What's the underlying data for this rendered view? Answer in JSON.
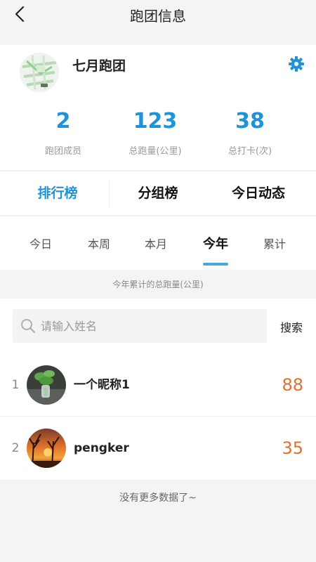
{
  "header": {
    "title": "跑团信息"
  },
  "club": {
    "name": "七月跑团",
    "stats": [
      {
        "value": "2",
        "label": "跑团成员"
      },
      {
        "value": "123",
        "label": "总跑量(公里)"
      },
      {
        "value": "38",
        "label": "总打卡(次)"
      }
    ]
  },
  "main_tabs": [
    {
      "label": "排行榜",
      "active": true
    },
    {
      "label": "分组榜",
      "active": false
    },
    {
      "label": "今日动态",
      "active": false
    }
  ],
  "period_tabs": [
    {
      "label": "今日",
      "active": false
    },
    {
      "label": "本周",
      "active": false
    },
    {
      "label": "本月",
      "active": false
    },
    {
      "label": "今年",
      "active": true
    },
    {
      "label": "累计",
      "active": false
    }
  ],
  "caption": "今年累计的总跑量(公里)",
  "search": {
    "placeholder": "请输入姓名",
    "value": "",
    "button_label": "搜索"
  },
  "ranking": [
    {
      "rank": "1",
      "name": "一个昵称1",
      "value": "88"
    },
    {
      "rank": "2",
      "name": "pengker",
      "value": "35"
    }
  ],
  "footer_note": "没有更多数据了~",
  "colors": {
    "accent": "#1f92d8",
    "value": "#e0712c",
    "underline": "#46a7dd"
  }
}
